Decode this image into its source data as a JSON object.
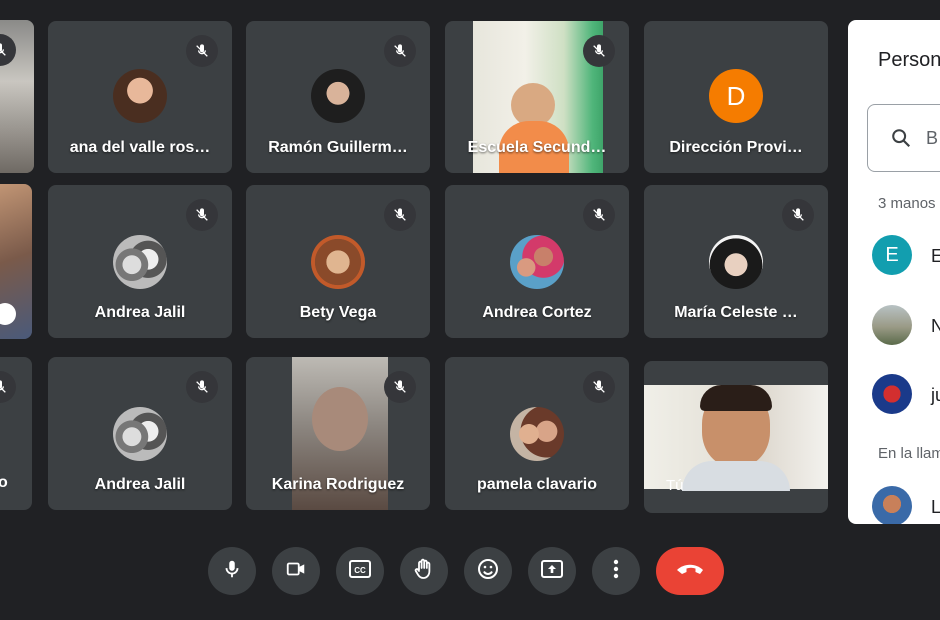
{
  "participants": [
    {
      "name": "ana del valle ros…"
    },
    {
      "name": "Ramón Guillerm…"
    },
    {
      "name": "Escuela Secund…"
    },
    {
      "name": "Dirección Provi…",
      "initial": "D",
      "color": "#f57c00"
    },
    {
      "name": "Andrea Jalil"
    },
    {
      "name": "Bety Vega"
    },
    {
      "name": "Andrea Cortez"
    },
    {
      "name": "María Celeste …"
    },
    {
      "name": "Andrea Jalil"
    },
    {
      "name": "Karina Rodriguez"
    },
    {
      "name": "pamela clavario"
    },
    {
      "name": "Tú"
    }
  ],
  "left_partial": {
    "row3_name": "o"
  },
  "panel": {
    "title": "Person",
    "search_placeholder": "B",
    "section_hands": "3 manos",
    "section_call": "En la llam",
    "people": [
      {
        "name": "E",
        "initial": "E",
        "color": "#129eaf"
      },
      {
        "name": "N"
      },
      {
        "name": "ju"
      },
      {
        "name": "L"
      }
    ]
  },
  "controls": {
    "mic": "mic-icon",
    "camera": "camera-icon",
    "captions": "captions-icon",
    "raise_hand": "hand-icon",
    "emoji": "emoji-icon",
    "present": "present-icon",
    "more": "more-icon",
    "hangup": "hangup-icon"
  },
  "colors": {
    "background": "#202124",
    "tile": "#3c4043",
    "hangup": "#ea4335"
  }
}
